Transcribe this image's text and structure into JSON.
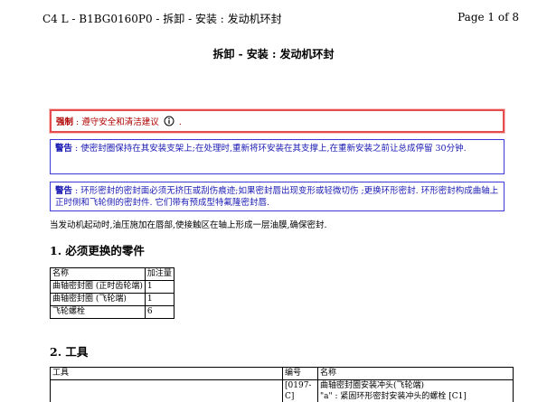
{
  "header": {
    "doc_id": "C4 L - B1BG0160P0 - 拆卸  - 安装 : 发动机环封",
    "page": "Page 1 of 8"
  },
  "title": "拆卸  - 安装 : 发动机环封",
  "notices": {
    "mandatory": {
      "label": "强制",
      "text": " : 遵守安全和清洁建议",
      "icon": "info-circle-icon",
      "tail": " ."
    },
    "warning1": {
      "label": "警告",
      "text": " : 使密封圈保持在其安装支架上;在处理时,重新将环安装在其支撑上,在重新安装之前让总成停留 30分钟."
    },
    "warning2": {
      "label": "警告",
      "text": " : 环形密封的密封面必须无挤压或刮伤痕迹;如果密封唇出现变形或轻微切伤 ;更换环形密封. 环形密封构成曲轴上正时侧和飞轮侧的密封件. 它们带有预成型特氟隆密封唇."
    }
  },
  "intro": "当发动机起动时,油压施加在唇部,使接触区在轴上形成一层油膜,确保密封.",
  "section1": {
    "heading": "1. 必须更换的零件",
    "columns": [
      "名称",
      "加注量"
    ],
    "rows": [
      [
        "曲轴密封圈 (正时齿轮端)",
        "1"
      ],
      [
        "曲轴密封圈 (飞轮端)",
        "1"
      ],
      [
        "飞轮螺栓",
        "6"
      ]
    ]
  },
  "section2": {
    "heading": "2. 工具",
    "columns": [
      "工具",
      "编号",
      "名称"
    ],
    "rows": [
      [
        "",
        "[0197-C]",
        "曲轴密封圈安装冲头(飞轮端)\n\"a\" : 紧固环形密封安装冲头的螺栓  [C1]"
      ]
    ]
  }
}
